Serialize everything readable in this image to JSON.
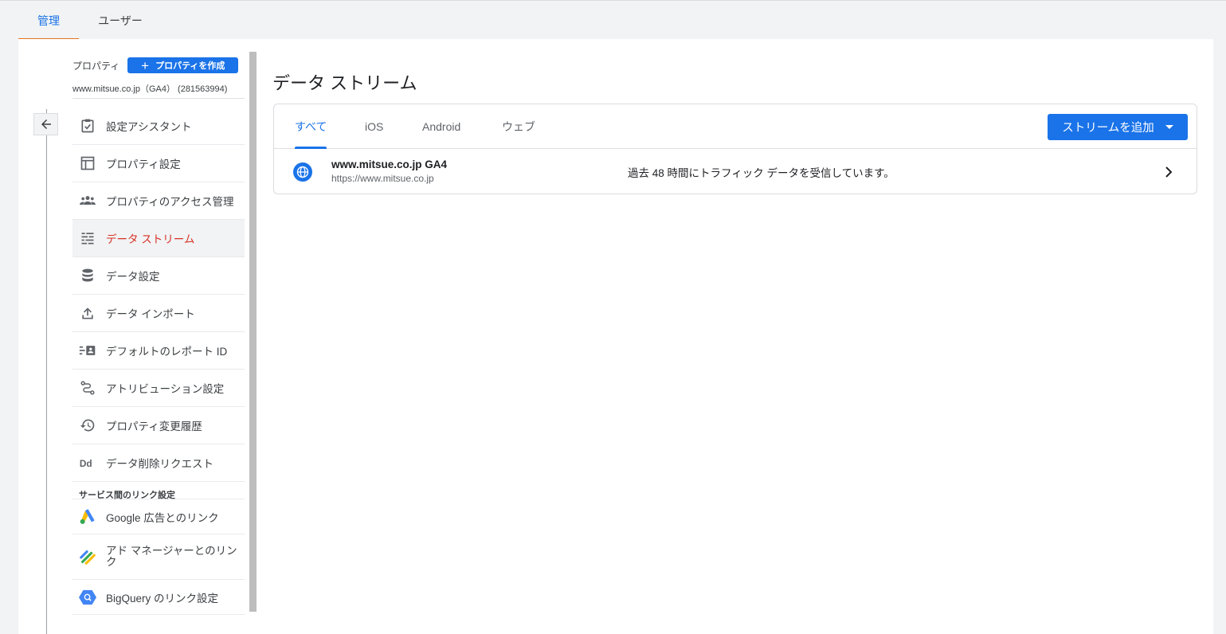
{
  "top_tabs": [
    "管理",
    "ユーザー"
  ],
  "nav": {
    "property_label": "プロパティ",
    "create_label": "プロパティを作成",
    "property_name": "www.mitsue.co.jp（GA4） (281563994)",
    "items": [
      {
        "label": "設定アシスタント",
        "icon": "clipboard-check-icon"
      },
      {
        "label": "プロパティ設定",
        "icon": "layout-icon"
      },
      {
        "label": "プロパティのアクセス管理",
        "icon": "people-icon"
      },
      {
        "label": "データ ストリーム",
        "icon": "streams-icon",
        "active": true
      },
      {
        "label": "データ設定",
        "icon": "database-icon"
      },
      {
        "label": "データ インポート",
        "icon": "upload-icon"
      },
      {
        "label": "デフォルトのレポート ID",
        "icon": "report-id-icon"
      },
      {
        "label": "アトリビューション設定",
        "icon": "attribution-icon"
      },
      {
        "label": "プロパティ変更履歴",
        "icon": "history-icon"
      },
      {
        "label": "データ削除リクエスト",
        "icon": "dd-icon"
      }
    ],
    "section_title": "サービス間のリンク設定",
    "links": [
      {
        "label": "Google 広告とのリンク",
        "icon": "google-ads-icon"
      },
      {
        "label": "アド マネージャーとのリンク",
        "icon": "ad-manager-icon"
      },
      {
        "label": "BigQuery のリンク設定",
        "icon": "bigquery-icon"
      }
    ]
  },
  "main": {
    "title": "データ ストリーム",
    "tabs": [
      "すべて",
      "iOS",
      "Android",
      "ウェブ"
    ],
    "active_tab": "すべて",
    "add_button": "ストリームを追加",
    "stream": {
      "name": "www.mitsue.co.jp GA4",
      "url": "https://www.mitsue.co.jp",
      "status": "過去 48 時間にトラフィック データを受信しています。"
    }
  },
  "colors": {
    "accent": "#1a73e8",
    "active_nav": "#d93025",
    "top_tab_underline": "#e8711a"
  }
}
